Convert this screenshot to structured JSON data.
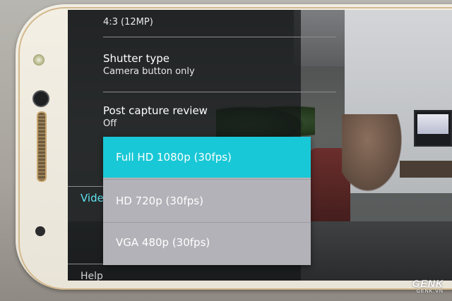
{
  "settings": {
    "resolution_value": "4:3 (12MP)",
    "shutter_type": {
      "title": "Shutter type",
      "value": "Camera button only"
    },
    "post_capture": {
      "title": "Post capture review",
      "value": "Off"
    }
  },
  "side": {
    "video_label": "Vide",
    "help_label": "Help"
  },
  "video_resolution_dropdown": {
    "options": [
      "Full HD 1080p (30fps)",
      "HD 720p (30fps)",
      "VGA 480p (30fps)"
    ],
    "selected": "Full HD 1080p (30fps)",
    "accent": "#19c8d6"
  },
  "watermark": {
    "logo": "GENK",
    "subtitle": "GENK.VN"
  }
}
